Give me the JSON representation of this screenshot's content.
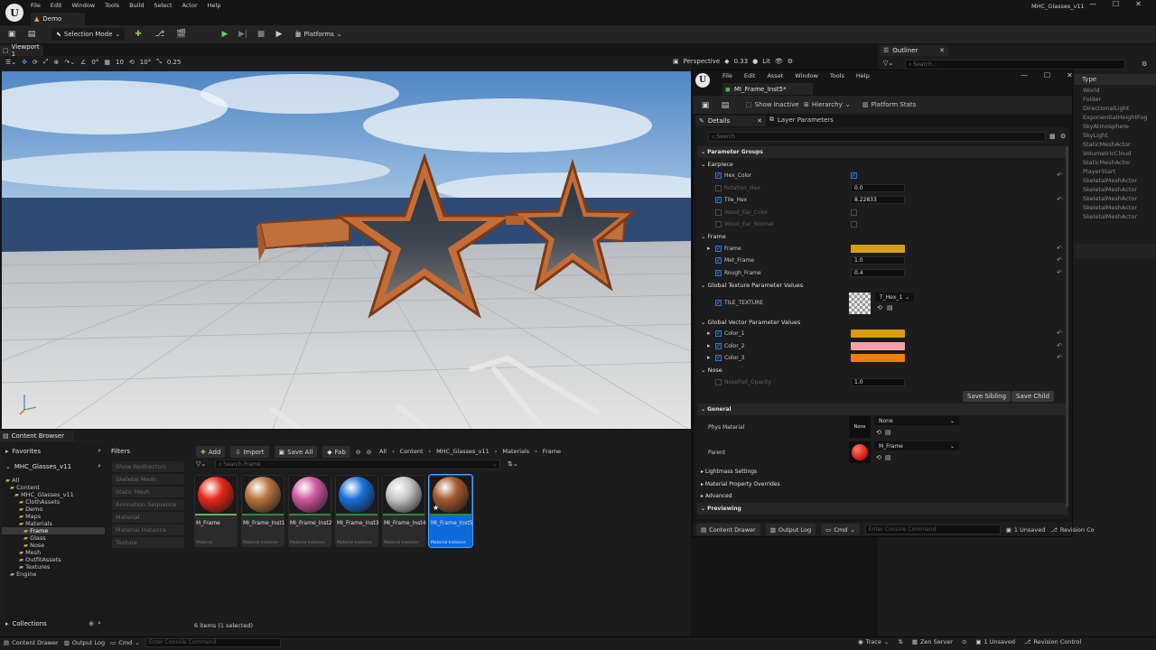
{
  "app": {
    "project_title": "MHC_Glasses_v11",
    "level_tab": "Demo",
    "menu": [
      "File",
      "Edit",
      "Window",
      "Tools",
      "Build",
      "Select",
      "Actor",
      "Help"
    ]
  },
  "toolbar": {
    "mode": "Selection Mode",
    "platforms": "Platforms"
  },
  "viewport": {
    "tab": "Viewport 1",
    "rotate_snap": "0°",
    "grid_snap": "10",
    "angle_snap": "10°",
    "scale_snap": "0.25",
    "perspective": "Perspective",
    "fov": "0.33",
    "view_mode": "Lit"
  },
  "outliner": {
    "tab": "Outliner",
    "search_placeholder": "Search...",
    "type_header": "Type",
    "types": [
      "World",
      "Folder",
      "DirectionalLight",
      "ExponentialHeightFog",
      "SkyAtmosphere",
      "SkyLight",
      "StaticMeshActor",
      "VolumetricCloud",
      "StaticMeshActor",
      "PlayerStart",
      "SkeletalMeshActor",
      "SkeletalMeshActor",
      "SkeletalMeshActor",
      "SkeletalMeshActor",
      "SkeletalMeshActor"
    ]
  },
  "mi_editor": {
    "menu": [
      "File",
      "Edit",
      "Asset",
      "Window",
      "Tools",
      "Help"
    ],
    "asset_tab": "MI_Frame_Inst5*",
    "show_inactive": "Show Inactive",
    "hierarchy": "Hierarchy",
    "platform_stats": "Platform Stats",
    "details_tab": "Details",
    "layer_tab": "Layer Parameters",
    "search_placeholder": "Search",
    "parameter_groups": "Parameter Groups",
    "earpiece": {
      "title": "Earpiece",
      "hex_color": "Hex_Color",
      "rotation_hex": "Rotation_Hex",
      "rotation_hex_val": "0.0",
      "tile_hex": "Tile_Hex",
      "tile_hex_val": "8.22833",
      "wood_ear_color": "Wood_Ear_Color",
      "wood_ear_normal": "Wood_Ear_Normal"
    },
    "frame": {
      "title": "Frame",
      "frame": "Frame",
      "frame_color": "#d4a017",
      "met_frame": "Met_Frame",
      "met_frame_val": "1.0",
      "rough_frame": "Rough_Frame",
      "rough_frame_val": "0.4"
    },
    "global_texture": {
      "title": "Global Texture Parameter Values",
      "tile_texture": "TILE_TEXTURE",
      "texture_value": "T_Hex_1"
    },
    "global_vector": {
      "title": "Global Vector Parameter Values",
      "color_1": "Color_1",
      "color_1_hex": "#d99a0b",
      "color_2": "Color_2",
      "color_2_hex": "#f2a2a8",
      "color_3": "Color_3",
      "color_3_hex": "#f57c00"
    },
    "nose": {
      "title": "Nose",
      "nosepad_opacity": "NosePad_Opacity",
      "nosepad_opacity_val": "1.0"
    },
    "save_sibling": "Save Sibling",
    "save_child": "Save Child",
    "general": {
      "title": "General",
      "phys_material": "Phys Material",
      "phys_thumb": "None",
      "phys_value": "None",
      "parent": "Parent",
      "parent_value": "M_Frame"
    },
    "collapsed": [
      "Lightmass Settings",
      "Material Property Overrides",
      "Advanced"
    ],
    "previewing": "Previewing",
    "status": {
      "content_drawer": "Content Drawer",
      "output_log": "Output Log",
      "cmd": "Cmd",
      "console_placeholder": "Enter Console Command",
      "unsaved": "1 Unsaved",
      "revision": "Revision Co"
    }
  },
  "content_browser": {
    "tab": "Content Browser",
    "favorites": "Favorites",
    "root": "MHC_Glasses_v11",
    "tree": [
      {
        "label": "All",
        "depth": 0
      },
      {
        "label": "Content",
        "depth": 1
      },
      {
        "label": "MHC_Glasses_v11",
        "depth": 2
      },
      {
        "label": "ClothAssets",
        "depth": 3
      },
      {
        "label": "Demo",
        "depth": 3
      },
      {
        "label": "Maps",
        "depth": 3
      },
      {
        "label": "Materials",
        "depth": 3
      },
      {
        "label": "Frame",
        "depth": 4,
        "selected": true
      },
      {
        "label": "Glass",
        "depth": 4
      },
      {
        "label": "Nose",
        "depth": 4
      },
      {
        "label": "Mesh",
        "depth": 3
      },
      {
        "label": "OutfitAssets",
        "depth": 3
      },
      {
        "label": "Textures",
        "depth": 3
      },
      {
        "label": "Engine",
        "depth": 1
      }
    ],
    "collections": "Collections",
    "filters_title": "Filters",
    "filters": [
      "Show Redirectors",
      "Skeletal Mesh",
      "Static Mesh",
      "Animation Sequence",
      "Material",
      "Material Instance",
      "Texture"
    ],
    "add": "Add",
    "import": "Import",
    "save_all": "Save All",
    "fab": "Fab",
    "breadcrumb": [
      "All",
      "Content",
      "MHC_Glasses_v11",
      "Materials",
      "Frame"
    ],
    "search_placeholder": "Search Frame",
    "assets": [
      {
        "name": "M_Frame",
        "type": "Material",
        "color": "#e8281c"
      },
      {
        "name": "MI_Frame_Inst1",
        "type": "Material Instance",
        "color": "#b9743f"
      },
      {
        "name": "MI_Frame_Inst2",
        "type": "Material Instance",
        "color": "#d25aa0"
      },
      {
        "name": "MI_Frame_Inst3",
        "type": "Material Instance",
        "color": "#1a6fd8"
      },
      {
        "name": "MI_Frame_Inst4",
        "type": "Material Instance",
        "color": "#c8c8c8"
      },
      {
        "name": "MI_Frame_Inst5",
        "type": "Material Instance",
        "color": "#a45a32"
      }
    ],
    "count": "6 items (1 selected)"
  },
  "statusbar": {
    "content_drawer": "Content Drawer",
    "output_log": "Output Log",
    "cmd": "Cmd",
    "console_placeholder": "Enter Console Command",
    "trace": "Trace",
    "zen": "Zen Server",
    "unsaved": "1 Unsaved",
    "revision": "Revision Control"
  }
}
